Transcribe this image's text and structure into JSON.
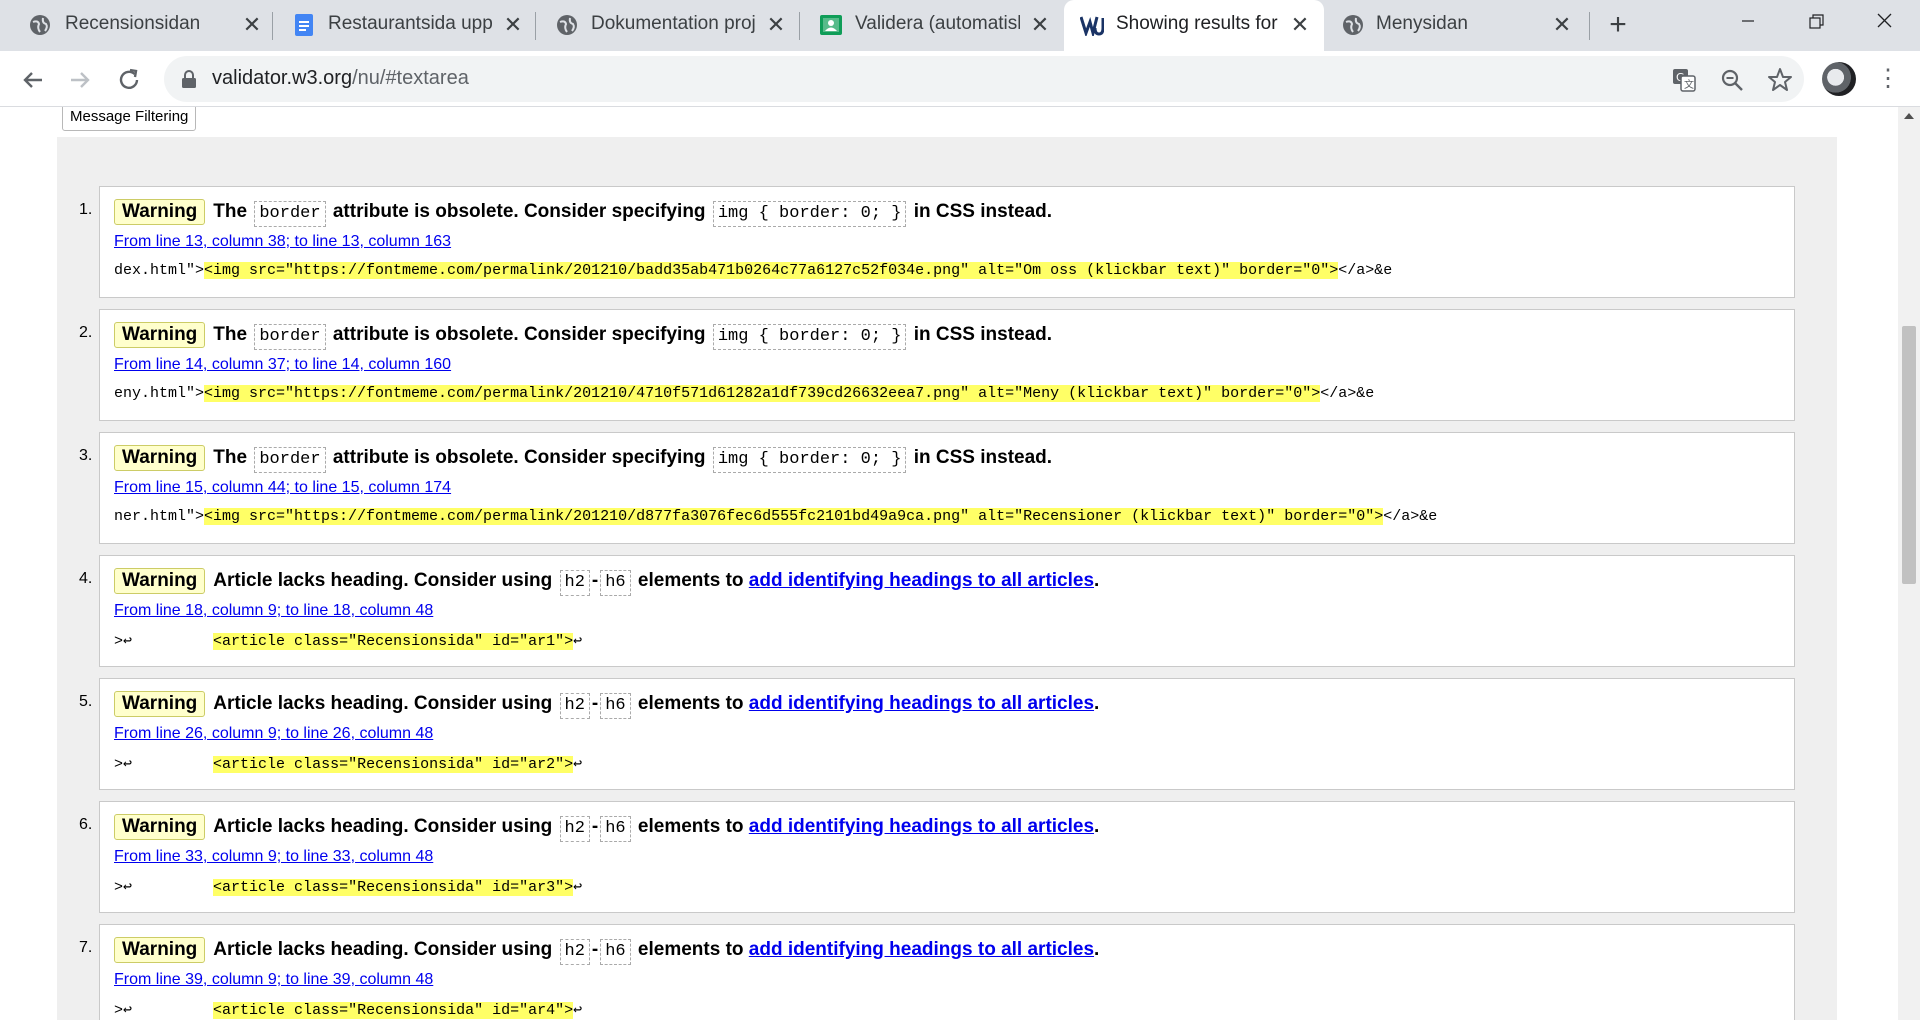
{
  "tabs": [
    {
      "title": "Recensionsidan",
      "favicon": "globe-icon",
      "active": false
    },
    {
      "title": "Restaurantsida uppg",
      "favicon": "docs-icon",
      "active": false
    },
    {
      "title": "Dokumentation proje",
      "favicon": "globe-icon",
      "active": false
    },
    {
      "title": "Validera (automatisk",
      "favicon": "classroom-icon",
      "active": false
    },
    {
      "title": "Showing results for c",
      "favicon": "w3c-validator-icon",
      "active": true
    },
    {
      "title": "Menysidan",
      "favicon": "globe-icon",
      "active": false
    }
  ],
  "toolbar": {
    "url_host": "validator.w3.org",
    "url_path": "/nu/#textarea"
  },
  "filter_button": "Message Filtering",
  "messages": [
    {
      "num": "1.",
      "type": "Warning",
      "parts": [
        "The",
        "border",
        "attribute is obsolete. Consider specifying",
        "img { border: 0; }",
        "in CSS instead."
      ],
      "location": "From line 13, column 38; to line 13, column 163",
      "extract_pre": "dex.html\">",
      "extract_hl": "<img src=\"https://fontmeme.com/permalink/201210/badd35ab471b0264c77a6127c52f034e.png\" alt=\"Om oss (klickbar text)\" border=\"0\">",
      "extract_post": "</a>&e"
    },
    {
      "num": "2.",
      "type": "Warning",
      "parts": [
        "The",
        "border",
        "attribute is obsolete. Consider specifying",
        "img { border: 0; }",
        "in CSS instead."
      ],
      "location": "From line 14, column 37; to line 14, column 160",
      "extract_pre": "eny.html\">",
      "extract_hl": "<img src=\"https://fontmeme.com/permalink/201210/4710f571d61282a1df739cd26632eea7.png\" alt=\"Meny (klickbar text)\" border=\"0\">",
      "extract_post": "</a>&e"
    },
    {
      "num": "3.",
      "type": "Warning",
      "parts": [
        "The",
        "border",
        "attribute is obsolete. Consider specifying",
        "img { border: 0; }",
        "in CSS instead."
      ],
      "location": "From line 15, column 44; to line 15, column 174",
      "extract_pre": "ner.html\">",
      "extract_hl": "<img src=\"https://fontmeme.com/permalink/201210/d877fa3076fec6d555fc2101bd49a9ca.png\" alt=\"Recensioner (klickbar text)\" border=\"0\">",
      "extract_post": "</a>&e"
    },
    {
      "num": "4.",
      "type": "Warning",
      "parts": [
        "Article lacks heading. Consider using",
        "h2",
        "-",
        "h6",
        "elements to",
        "add identifying headings to all articles",
        "."
      ],
      "location": "From line 18, column 9; to line 18, column 48",
      "extract_pre": ">↩         ",
      "extract_hl": "<article class=\"Recensionsida\" id=\"ar1\">",
      "extract_post": "↩"
    },
    {
      "num": "5.",
      "type": "Warning",
      "parts": [
        "Article lacks heading. Consider using",
        "h2",
        "-",
        "h6",
        "elements to",
        "add identifying headings to all articles",
        "."
      ],
      "location": "From line 26, column 9; to line 26, column 48",
      "extract_pre": ">↩         ",
      "extract_hl": "<article class=\"Recensionsida\" id=\"ar2\">",
      "extract_post": "↩"
    },
    {
      "num": "6.",
      "type": "Warning",
      "parts": [
        "Article lacks heading. Consider using",
        "h2",
        "-",
        "h6",
        "elements to",
        "add identifying headings to all articles",
        "."
      ],
      "location": "From line 33, column 9; to line 33, column 48",
      "extract_pre": ">↩         ",
      "extract_hl": "<article class=\"Recensionsida\" id=\"ar3\">",
      "extract_post": "↩"
    },
    {
      "num": "7.",
      "type": "Warning",
      "parts": [
        "Article lacks heading. Consider using",
        "h2",
        "-",
        "h6",
        "elements to",
        "add identifying headings to all articles",
        "."
      ],
      "location": "From line 39, column 9; to line 39, column 48",
      "extract_pre": ">↩         ",
      "extract_hl": "<article class=\"Recensionsida\" id=\"ar4\">",
      "extract_post": "↩"
    }
  ]
}
